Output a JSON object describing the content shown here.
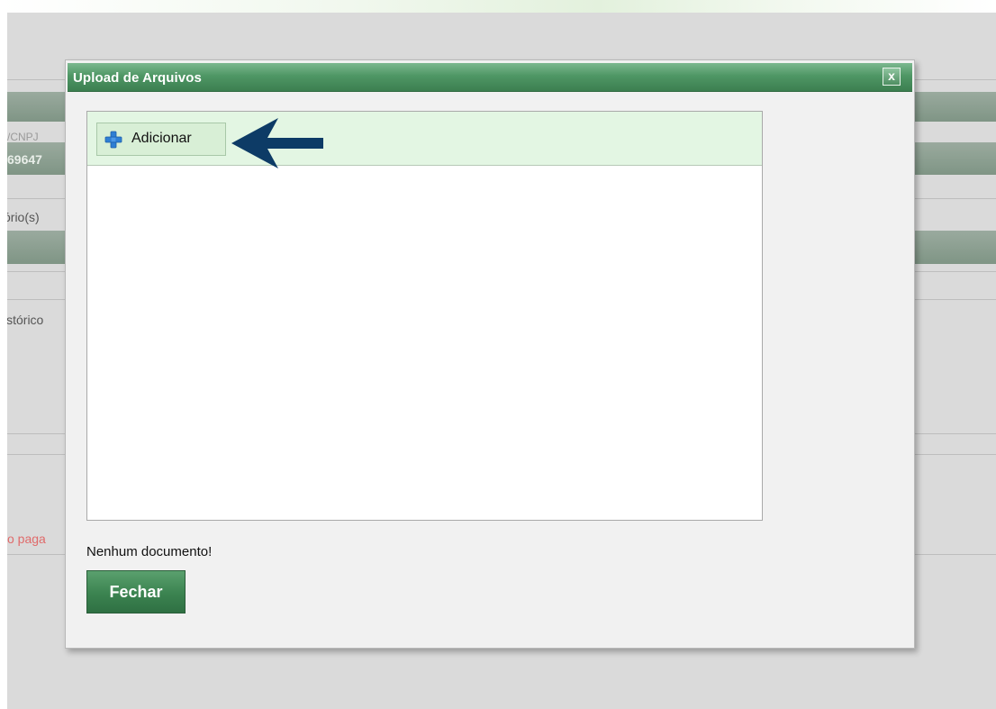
{
  "background": {
    "fragments": {
      "faint_label": "/CNPJ",
      "number": "69647",
      "label": "ório(s)",
      "historico": "istórico",
      "warning": "o paga"
    }
  },
  "modal": {
    "title": "Upload de Arquivos",
    "close_label": "x",
    "add_button_label": "Adicionar",
    "status": "Nenhum documento!",
    "close_button_label": "Fechar"
  },
  "colors": {
    "titlebar": "#4f9765",
    "toolbar_bg": "#e3f6e3",
    "arrow": "#0d3b66",
    "plus": "#2f7fd4",
    "warning_text": "#e06a6a"
  },
  "icons": {
    "add": "plus-icon",
    "pointer": "arrow-left-icon",
    "close": "close-icon"
  }
}
